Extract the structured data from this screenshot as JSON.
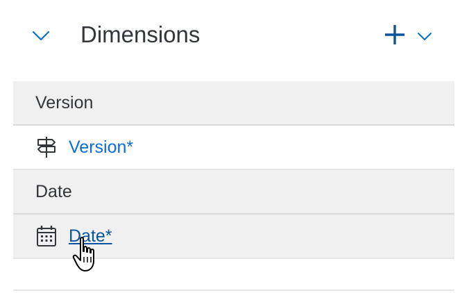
{
  "panel": {
    "title": "Dimensions",
    "collapse_icon": "chevron-down-icon",
    "add_icon": "plus-icon",
    "add_menu_icon": "chevron-down-icon"
  },
  "groups": [
    {
      "header": "Version",
      "items": [
        {
          "label": "Version*",
          "icon": "signpost-icon"
        }
      ]
    },
    {
      "header": "Date",
      "items": [
        {
          "label": "Date*",
          "icon": "calendar-icon",
          "state": "hover"
        }
      ]
    }
  ],
  "colors": {
    "accent": "#0a6ed1",
    "plus": "#0854a0",
    "text": "#32363a",
    "group_background": "#f0f0f0"
  },
  "cursor": "hand-pointer-cursor"
}
